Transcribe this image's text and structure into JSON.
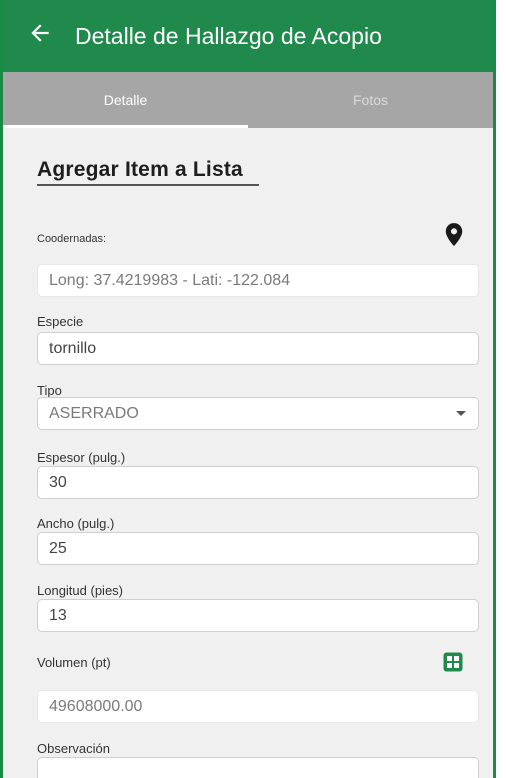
{
  "appbar": {
    "back_icon": "arrow-left-icon",
    "title": "Detalle de Hallazgo de Acopio",
    "color": "#1f8a4c"
  },
  "tabs": [
    {
      "label": "Detalle",
      "selected": true
    },
    {
      "label": "Fotos",
      "selected": false
    }
  ],
  "section_title": "Agregar Item a Lista",
  "form": {
    "coordenadas": {
      "label": "Coodernadas:",
      "value": "Long: 37.4219983 - Lati: -122.084",
      "icon": "map-pin-icon"
    },
    "especie": {
      "label": "Especie",
      "value": "tornillo"
    },
    "tipo": {
      "label": "Tipo",
      "value": "ASERRADO"
    },
    "espesor": {
      "label": "Espesor (pulg.)",
      "value": "30"
    },
    "ancho": {
      "label": "Ancho (pulg.)",
      "value": "25"
    },
    "longitud": {
      "label": "Longitud (pies)",
      "value": "13"
    },
    "volumen": {
      "label": "Volumen (pt)",
      "value": "49608000.00",
      "icon": "calculator-icon",
      "icon_color": "#1f8a4c"
    },
    "observacion": {
      "label": "Observación",
      "value": ""
    }
  }
}
